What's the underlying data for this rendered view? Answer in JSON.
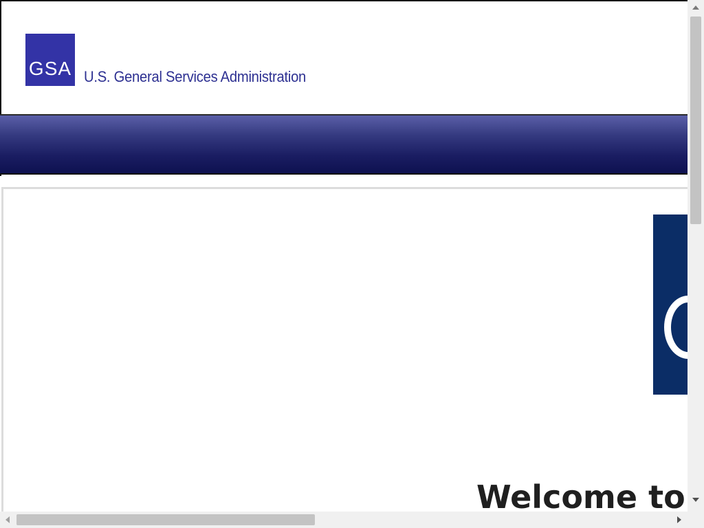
{
  "header": {
    "logo_text": "GSA",
    "agency_name": "U.S. General Services Administration"
  },
  "main": {
    "welcome_heading": "Welcome to"
  },
  "colors": {
    "logo_background": "#3333a6",
    "agency_text": "#2e3192",
    "nav_bar": "#1a1d62",
    "hero_panel": "#0b2d66"
  },
  "icons": {
    "scroll_up": "arrow-up-icon",
    "scroll_down": "arrow-down-icon",
    "scroll_left": "arrow-left-icon",
    "scroll_right": "arrow-right-icon"
  }
}
